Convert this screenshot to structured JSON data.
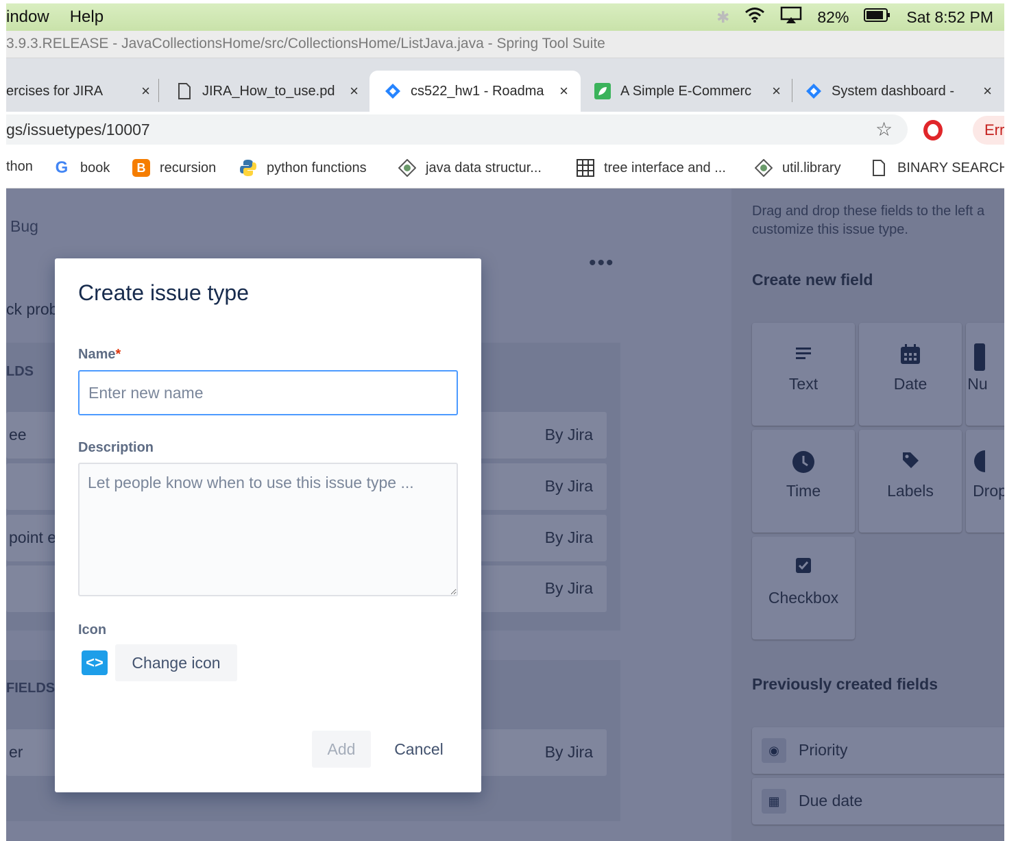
{
  "menubar": {
    "items": [
      "indow",
      "Help"
    ],
    "battery": "82%",
    "clock": "Sat 8:52 PM"
  },
  "window_title": "3.9.3.RELEASE - JavaCollectionsHome/src/CollectionsHome/ListJava.java - Spring Tool Suite",
  "tabs": [
    {
      "label": "ercises for JIRA",
      "icon": "none",
      "close": "×"
    },
    {
      "label": "JIRA_How_to_use.pd",
      "icon": "document-icon",
      "close": "×"
    },
    {
      "label": "cs522_hw1 - Roadma",
      "icon": "jira-icon",
      "close": "×"
    },
    {
      "label": "A Simple E-Commerc",
      "icon": "leaf-icon",
      "close": "×"
    },
    {
      "label": "System dashboard -",
      "icon": "jira-icon",
      "close": "×"
    }
  ],
  "omnibox": {
    "url": "gs/issuetypes/10007",
    "err_label": "Err"
  },
  "bookmarks": [
    {
      "label": "thon",
      "icon": "none"
    },
    {
      "label": "book",
      "icon": "google-icon"
    },
    {
      "label": "recursion",
      "icon": "blogger-icon"
    },
    {
      "label": "python functions",
      "icon": "python-icon"
    },
    {
      "label": "java data structur...",
      "icon": "globe-icon"
    },
    {
      "label": "tree interface and ...",
      "icon": "grid-icon"
    },
    {
      "label": "util.library",
      "icon": "globe-icon"
    },
    {
      "label": "BINARY SEARCH",
      "icon": "document-icon"
    }
  ],
  "background": {
    "crumb": "Bug",
    "frag_prob": "ck prob",
    "frag_lds": "LDS",
    "frag_ee": "ee",
    "frag_point": "point e",
    "frag_fields": "FIELDS",
    "frag_er": "er",
    "by_jira": "By Jira",
    "more": "•••"
  },
  "right_panel": {
    "help_text": "Drag and drop these fields to the left a customize this issue type.",
    "create_heading": "Create new field",
    "field_types": [
      {
        "label": "Text",
        "icon": "text-lines-icon"
      },
      {
        "label": "Date",
        "icon": "calendar-icon"
      },
      {
        "label": "Nu",
        "icon": "number-icon"
      },
      {
        "label": "Time",
        "icon": "clock-icon"
      },
      {
        "label": "Labels",
        "icon": "tag-icon"
      },
      {
        "label": "Drop",
        "icon": "dropdown-icon"
      },
      {
        "label": "Checkbox",
        "icon": "checkbox-icon"
      }
    ],
    "previous_heading": "Previously created fields",
    "previous_fields": [
      {
        "label": "Priority",
        "icon": "priority-icon"
      },
      {
        "label": "Due date",
        "icon": "calendar-icon"
      }
    ]
  },
  "modal": {
    "title": "Create issue type",
    "name_label": "Name",
    "required_mark": "*",
    "name_placeholder": "Enter new name",
    "description_label": "Description",
    "description_placeholder": "Let people know when to use this issue type ...",
    "icon_label": "Icon",
    "change_icon_label": "Change icon",
    "add_label": "Add",
    "cancel_label": "Cancel"
  },
  "colors": {
    "input_focus": "#4c9aff",
    "overlay": "#7a8099",
    "title_text": "#172b4d",
    "required": "#de350b"
  }
}
